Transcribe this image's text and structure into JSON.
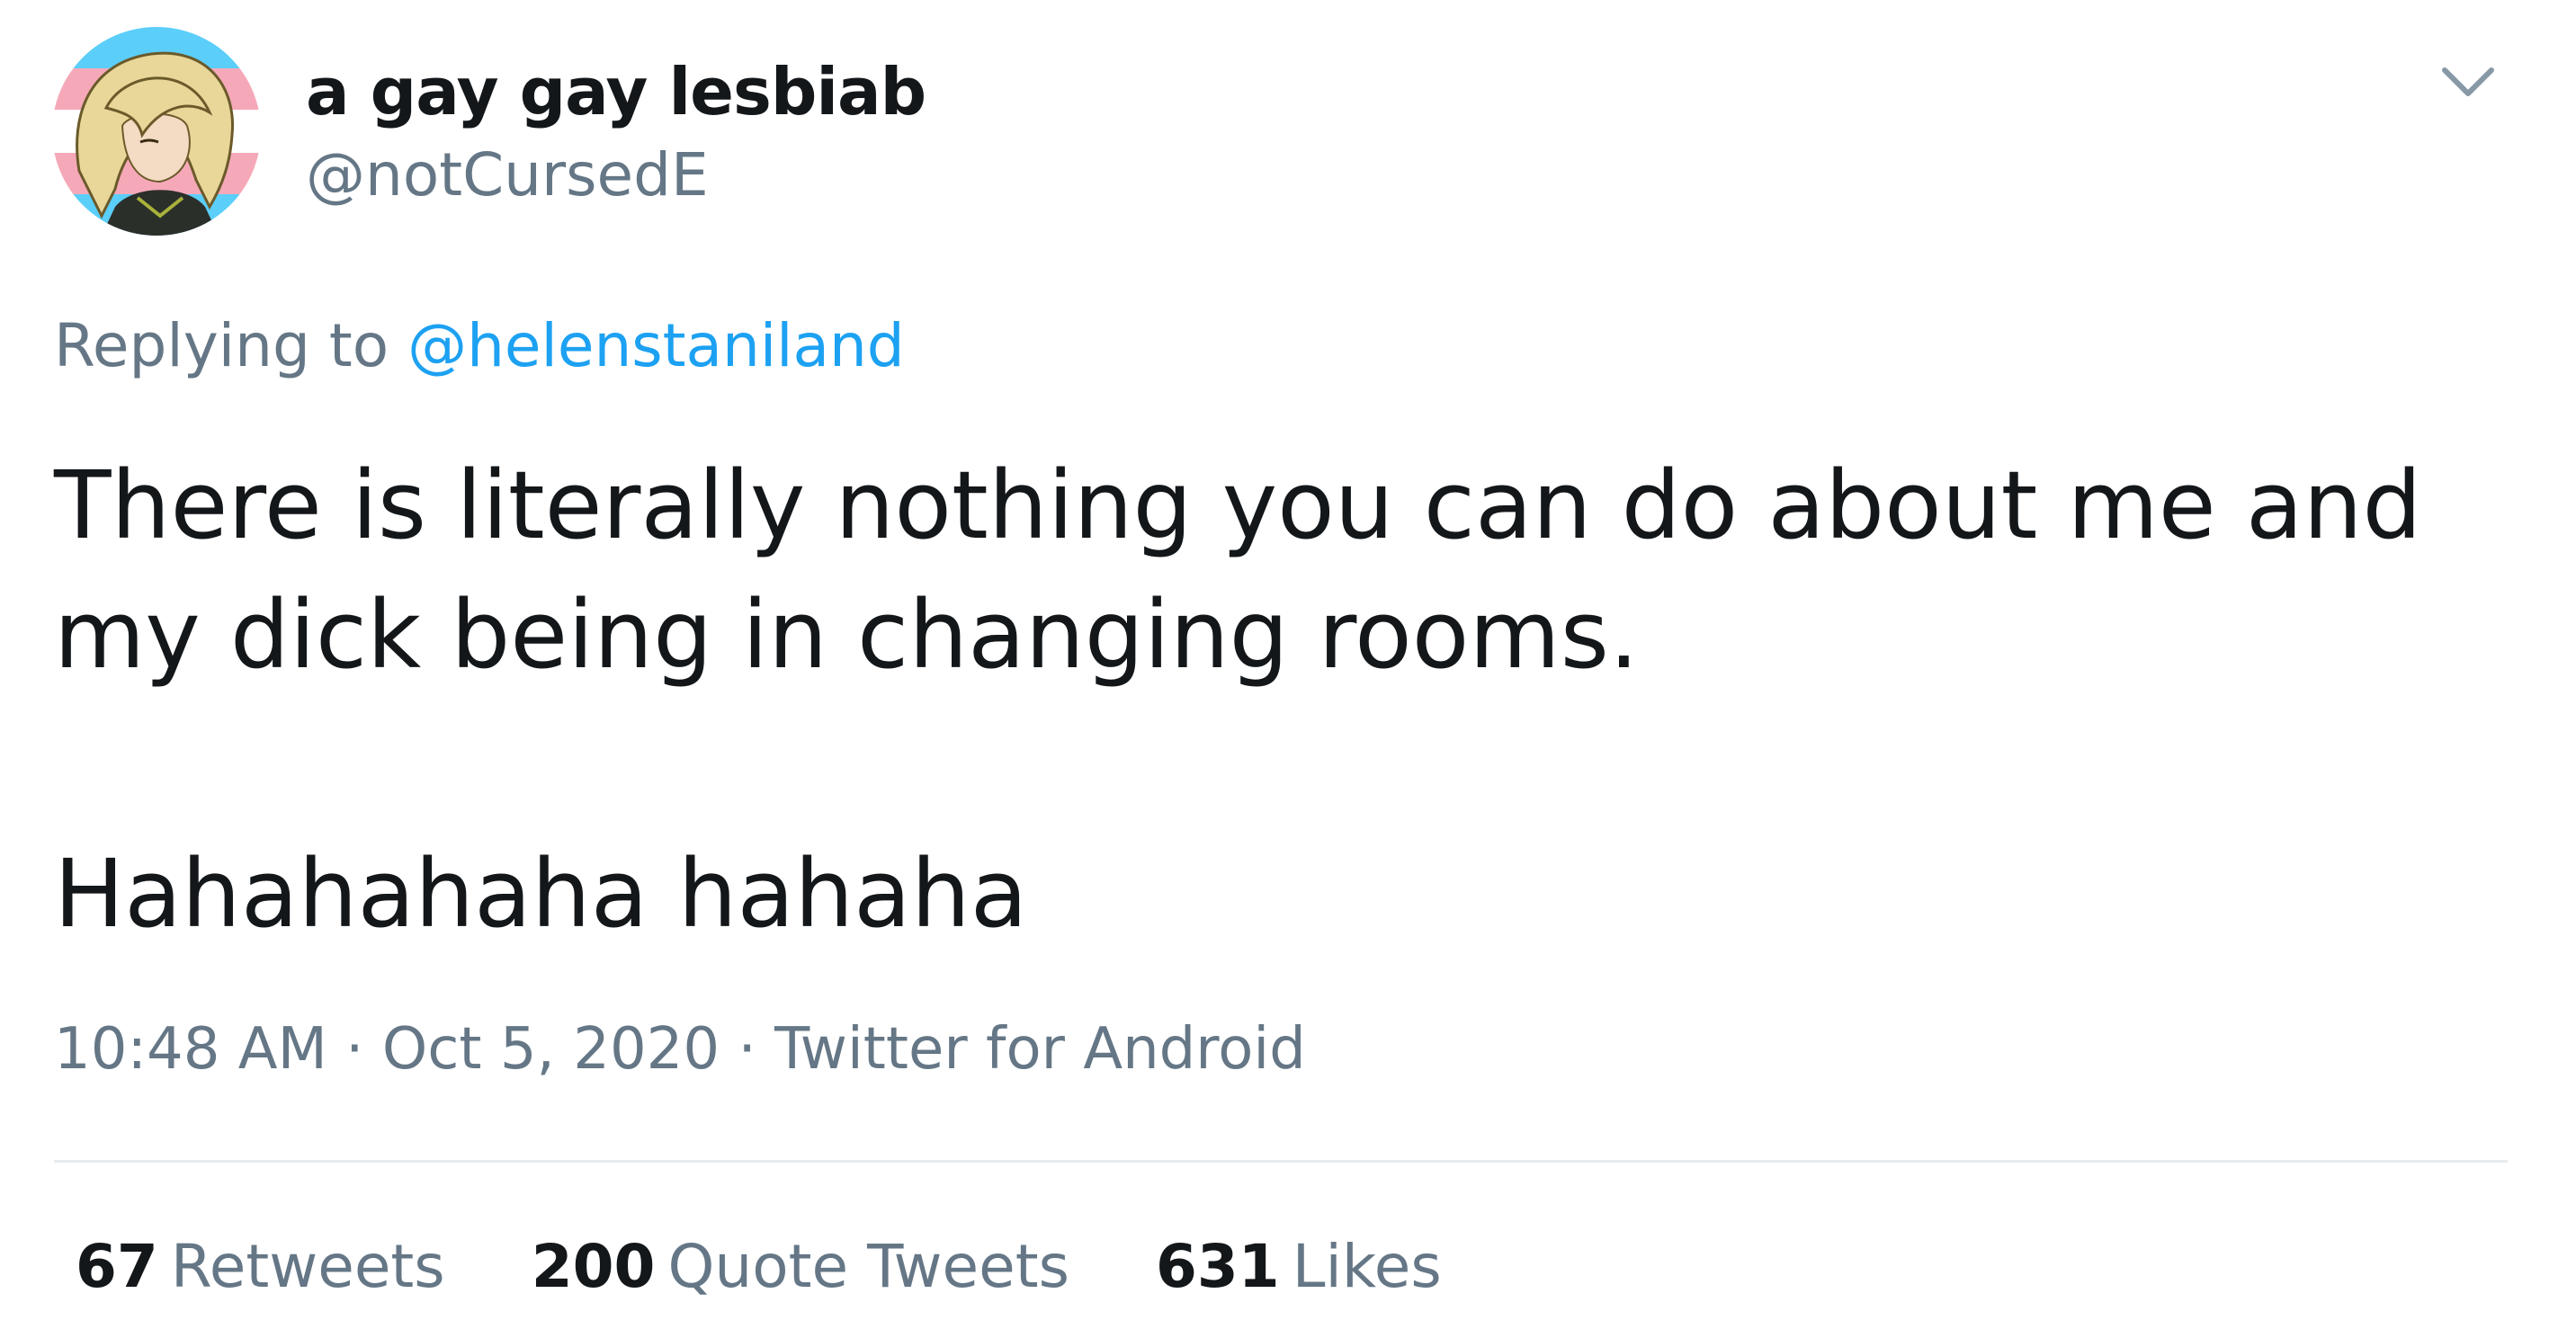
{
  "user": {
    "display_name": "a gay gay lesbiab",
    "handle": "@notCursedE"
  },
  "reply": {
    "prefix": "Replying to",
    "mention": "@helenstaniland"
  },
  "tweet": {
    "line1": "There is literally nothing you can do about me and my dick being in changing rooms.",
    "line2": "Hahahahaha hahaha"
  },
  "meta": {
    "time": "10:48 AM",
    "date": "Oct 5, 2020",
    "source": "Twitter for Android",
    "separator": "·"
  },
  "stats": [
    {
      "count": "67",
      "label": "Retweets"
    },
    {
      "count": "200",
      "label": "Quote Tweets"
    },
    {
      "count": "631",
      "label": "Likes"
    }
  ],
  "colors": {
    "link": "#1da1f2",
    "secondary_text": "#657786",
    "primary_text": "#14171a",
    "flag_blue": "#5bcefa",
    "flag_pink": "#f5a9b8"
  },
  "icons": {
    "menu": "chevron-down-icon",
    "avatar": "avatar"
  }
}
